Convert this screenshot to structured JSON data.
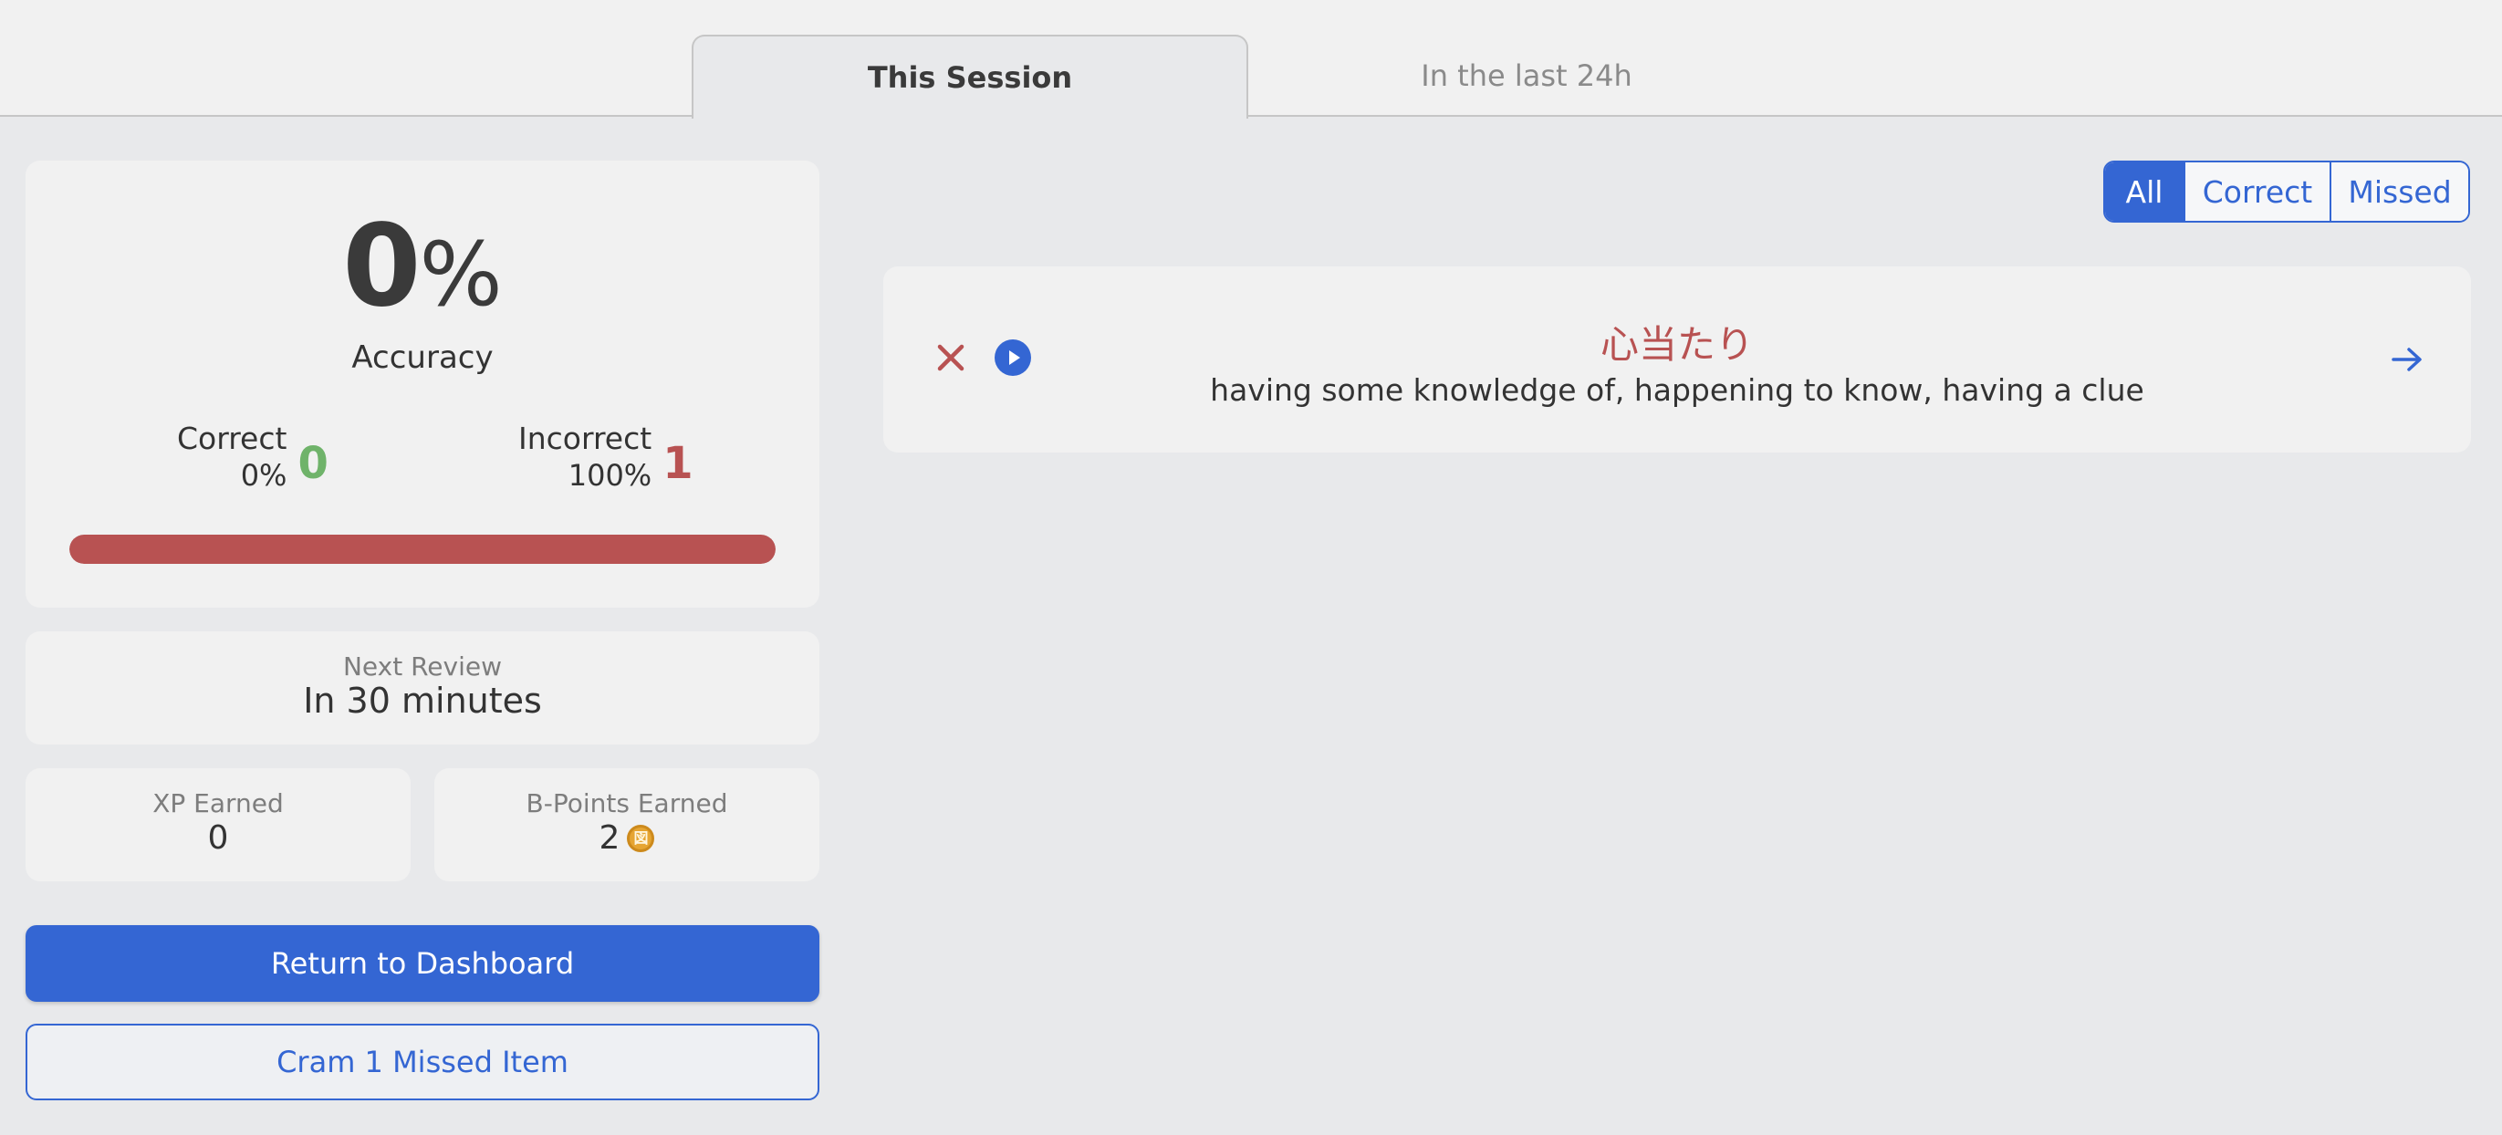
{
  "tabs": {
    "session": "This Session",
    "last24": "In the last 24h"
  },
  "summary": {
    "accuracy_value": "0",
    "accuracy_unit": "%",
    "accuracy_label": "Accuracy",
    "correct": {
      "title": "Correct",
      "percent": "0%",
      "count": "0"
    },
    "incorrect": {
      "title": "Incorrect",
      "percent": "100%",
      "count": "1"
    },
    "incorrect_fraction": 1.0
  },
  "next_review": {
    "label": "Next Review",
    "value": "In 30 minutes"
  },
  "xp": {
    "label": "XP Earned",
    "value": "0"
  },
  "bpoints": {
    "label": "B-Points Earned",
    "value": "2",
    "coin_glyph": "図"
  },
  "buttons": {
    "dashboard": "Return to Dashboard",
    "cram": "Cram 1 Missed Item"
  },
  "filters": {
    "all": "All",
    "correct": "Correct",
    "missed": "Missed",
    "selected": "All"
  },
  "items": [
    {
      "word": "心当たり",
      "meaning": "having some knowledge of, happening to know, having a clue",
      "status": "missed"
    }
  ],
  "icons": {
    "wrong": "x-icon",
    "audio": "play-icon",
    "open": "arrow-right-icon",
    "coin": "coin-icon"
  },
  "colors": {
    "accent": "#3466d3",
    "correct": "#6fb36a",
    "incorrect": "#b85252"
  }
}
